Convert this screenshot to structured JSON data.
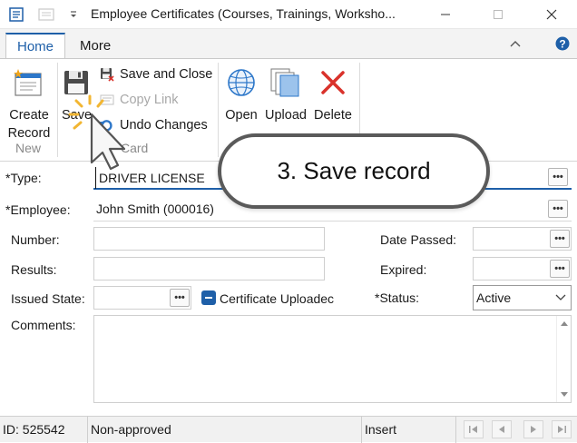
{
  "window": {
    "title": "Employee Certificates (Courses, Trainings, Worksho..."
  },
  "ribbon": {
    "tabs": [
      {
        "label": "Home",
        "active": true
      },
      {
        "label": "More",
        "active": false
      }
    ],
    "new_group": {
      "create_record_line1": "Create",
      "create_record_line2": "Record",
      "group_label": "New"
    },
    "card_group": {
      "save_label": "Save",
      "save_and_close_label": "Save and Close",
      "copy_link_label": "Copy Link",
      "undo_changes_label": "Undo Changes",
      "group_label": "Card"
    },
    "file_group": {
      "open_label": "Open",
      "upload_label": "Upload",
      "delete_label": "Delete"
    }
  },
  "form": {
    "type_label": "*Type:",
    "type_value": "DRIVER LICENSE",
    "employee_label": "*Employee:",
    "employee_value": "John Smith (000016)",
    "number_label": "Number:",
    "number_value": "",
    "results_label": "Results:",
    "results_value": "",
    "issued_state_label": "Issued State:",
    "issued_state_value": "",
    "certificate_uploaded_label": "Certificate Uploadec",
    "certificate_uploaded_checked": "indeterminate",
    "date_passed_label": "Date Passed:",
    "date_passed_value": "",
    "expired_label": "Expired:",
    "expired_value": "",
    "status_label": "*Status:",
    "status_value": "Active",
    "comments_label": "Comments:",
    "comments_value": ""
  },
  "statusbar": {
    "id_text": "ID: 525542",
    "approval_text": "Non-approved",
    "mode_text": "Insert"
  },
  "callout": {
    "text": "3. Save record"
  },
  "colors": {
    "accent": "#1e5fa8",
    "delete_red": "#d9322b",
    "callout_border": "#5a5a5a"
  }
}
